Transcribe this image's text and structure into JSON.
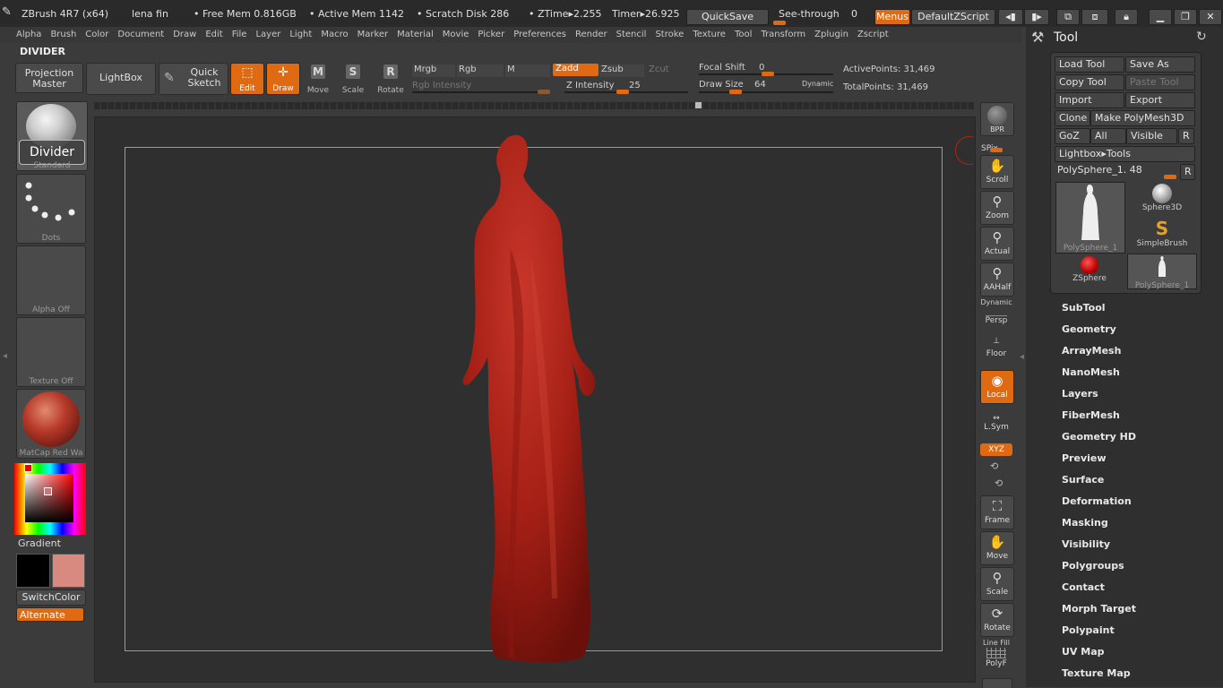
{
  "titlebar": {
    "app": "ZBrush 4R7 (x64)",
    "doc": "lena fin",
    "free_mem": "• Free Mem 0.816GB",
    "active_mem": "• Active Mem 1142",
    "scratch": "• Scratch Disk 286",
    "ztime": "• ZTime▸2.255",
    "timer": "Timer▸26.925",
    "quicksave": "QuickSave",
    "seethrough": "See-through",
    "seethrough_value": "0",
    "menus": "Menus",
    "script": "DefaultZScript"
  },
  "menubar": [
    "Alpha",
    "Brush",
    "Color",
    "Document",
    "Draw",
    "Edit",
    "File",
    "Layer",
    "Light",
    "Macro",
    "Marker",
    "Material",
    "Movie",
    "Picker",
    "Preferences",
    "Render",
    "Stencil",
    "Stroke",
    "Texture",
    "Tool",
    "Transform",
    "Zplugin",
    "Zscript"
  ],
  "toolbar": {
    "divider_title": "DIVIDER",
    "projection_master": "Projection Master",
    "lightbox": "LightBox",
    "quick_sketch": "Quick Sketch",
    "edit": "Edit",
    "draw": "Draw",
    "move": "Move",
    "scale": "Scale",
    "rotate": "Rotate",
    "mrgb": "Mrgb",
    "rgb": "Rgb",
    "m": "M",
    "zadd": "Zadd",
    "zsub": "Zsub",
    "zcut": "Zcut",
    "rgb_intensity": "Rgb Intensity",
    "z_intensity_label": "Z Intensity",
    "z_intensity_value": "25",
    "focal_shift_label": "Focal Shift",
    "focal_shift_value": "0",
    "draw_size_label": "Draw Size",
    "draw_size_value": "64",
    "dynamic": "Dynamic",
    "active_points": "ActivePoints: 31,469",
    "total_points": "TotalPoints: 31,469"
  },
  "leftshelf": {
    "brush_name": "Divider",
    "brush_sub": "Standard",
    "stroke": "Dots",
    "alpha": "Alpha Off",
    "texture": "Texture Off",
    "material": "MatCap Red Wa",
    "gradient": "Gradient",
    "switchcolor": "SwitchColor",
    "alternate": "Alternate",
    "colors": {
      "main": "#000000",
      "secondary": "#d98a80",
      "material": "#b83a2a"
    }
  },
  "rightshelf": {
    "bpr": "BPR",
    "spix": "SPix",
    "scroll": "Scroll",
    "zoom": "Zoom",
    "actual": "Actual",
    "aahalf": "AAHalf",
    "dynamic": "Dynamic",
    "persp": "Persp",
    "floor": "Floor",
    "local": "Local",
    "lsym": "L.Sym",
    "xyz": "XYZ",
    "frame": "Frame",
    "move": "Move",
    "scale": "Scale",
    "rotate": "Rotate",
    "line_fill": "Line Fill",
    "polyf": "PolyF"
  },
  "toolpanel": {
    "title": "Tool",
    "load_tool": "Load Tool",
    "save_as": "Save As",
    "copy_tool": "Copy Tool",
    "paste_tool": "Paste Tool",
    "import": "Import",
    "export": "Export",
    "clone": "Clone",
    "make_polymesh": "Make PolyMesh3D",
    "goz": "GoZ",
    "all": "All",
    "visible": "Visible",
    "r": "R",
    "lightbox_tools": "Lightbox▸Tools",
    "current_tool": "PolySphere_1. 48",
    "thumbs": [
      "PolySphere_1",
      "Sphere3D",
      "SimpleBrush",
      "ZSphere",
      "PolySphere_1"
    ],
    "sections": [
      "SubTool",
      "Geometry",
      "ArrayMesh",
      "NanoMesh",
      "Layers",
      "FiberMesh",
      "Geometry HD",
      "Preview",
      "Surface",
      "Deformation",
      "Masking",
      "Visibility",
      "Polygroups",
      "Contact",
      "Morph Target",
      "Polypaint",
      "UV Map",
      "Texture Map"
    ]
  },
  "model": {
    "color": "#b02418"
  }
}
